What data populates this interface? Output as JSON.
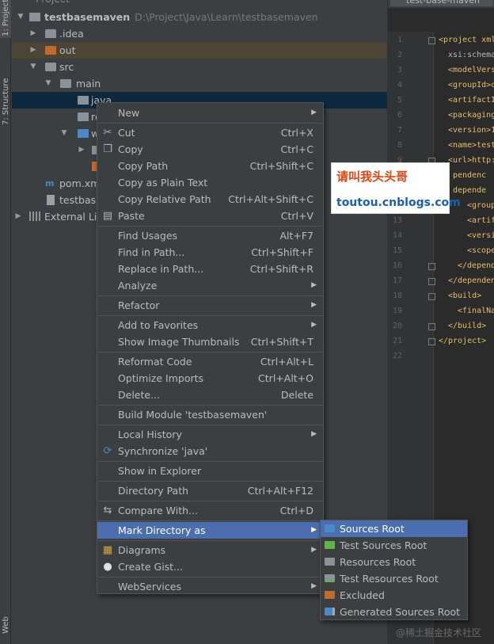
{
  "side_tabs": {
    "project": "1: Project",
    "structure": "7: Structure",
    "web": "Web"
  },
  "tree": {
    "header": "Project",
    "root": {
      "name": "testbasemaven",
      "path": "D:\\Project\\Java\\Learn\\testbasemaven"
    },
    "idea": ".idea",
    "out": "out",
    "src": "src",
    "main": "main",
    "java": "java",
    "resources": "re",
    "webapp": "w",
    "pom": "pom.xm",
    "iml": "testbase",
    "external": "External Lib"
  },
  "editor": {
    "tab_label": "test-base-maven",
    "line_numbers": [
      "1",
      "2",
      "3",
      "4",
      "5",
      "6",
      "7",
      "8",
      "9",
      "10",
      "11",
      "12",
      "13",
      "14",
      "15",
      "16",
      "17",
      "18",
      "19",
      "20",
      "21",
      "22"
    ],
    "lines": {
      "l1": "<project xml",
      "l2": "xsi:schema",
      "l3": "<modelVers",
      "l4": "<groupId>c",
      "l5": "<artifactI",
      "l6": "<packaging",
      "l7": "<version>1",
      "l8": "<name>test",
      "l9": "<url>http:",
      "l10": "pendenc",
      "l11": "depende",
      "l12": "<group",
      "l13": "<artif",
      "l14": "<versi",
      "l15": "<scope",
      "l16": "</depend",
      "l17": "</dependen",
      "l18": "<build>",
      "l19": "<finalNa",
      "l20": "</build>",
      "l21": "</project>"
    }
  },
  "watermark": {
    "line1": "请叫我头头哥",
    "line2": "toutou.cnblogs.com"
  },
  "context_menu": {
    "new": "New",
    "cut": "Cut",
    "cut_sc": "Ctrl+X",
    "copy": "Copy",
    "copy_sc": "Ctrl+C",
    "copy_path": "Copy Path",
    "copy_path_sc": "Ctrl+Shift+C",
    "copy_plain": "Copy as Plain Text",
    "copy_relative": "Copy Relative Path",
    "copy_relative_sc": "Ctrl+Alt+Shift+C",
    "paste": "Paste",
    "paste_sc": "Ctrl+V",
    "find_usages": "Find Usages",
    "find_usages_sc": "Alt+F7",
    "find_in_path": "Find in Path...",
    "find_in_path_sc": "Ctrl+Shift+F",
    "replace_in_path": "Replace in Path...",
    "replace_in_path_sc": "Ctrl+Shift+R",
    "analyze": "Analyze",
    "refactor": "Refactor",
    "add_favorites": "Add to Favorites",
    "show_thumbnails": "Show Image Thumbnails",
    "show_thumbnails_sc": "Ctrl+Shift+T",
    "reformat": "Reformat Code",
    "reformat_sc": "Ctrl+Alt+L",
    "optimize": "Optimize Imports",
    "optimize_sc": "Ctrl+Alt+O",
    "delete": "Delete...",
    "delete_sc": "Delete",
    "build_module": "Build Module 'testbasemaven'",
    "local_history": "Local History",
    "synchronize": "Synchronize 'java'",
    "show_explorer": "Show in Explorer",
    "directory_path": "Directory Path",
    "directory_path_sc": "Ctrl+Alt+F12",
    "compare_with": "Compare With...",
    "compare_with_sc": "Ctrl+D",
    "mark_directory": "Mark Directory as",
    "diagrams": "Diagrams",
    "create_gist": "Create Gist...",
    "webservices": "WebServices"
  },
  "submenu": {
    "sources_root": "Sources Root",
    "test_sources_root": "Test Sources Root",
    "resources_root": "Resources Root",
    "test_resources_root": "Test Resources Root",
    "excluded": "Excluded",
    "generated_sources_root": "Generated Sources Root"
  },
  "colors": {
    "selection": "#4b6eaf",
    "sources_root_icon": "#4a88c7",
    "test_sources_root_icon": "#62b543",
    "resources_root_icon": "#8c9299",
    "excluded_icon": "#c06a2d"
  },
  "credit": "@稀土掘金技术社区"
}
